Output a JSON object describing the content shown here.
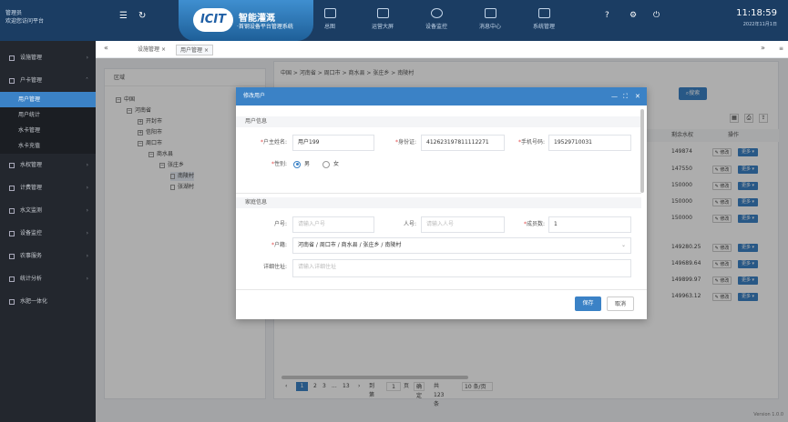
{
  "header": {
    "user_role": "管理员",
    "welcome": "欢迎您访问平台",
    "logo_mark": "ICIT",
    "logo_title": "智能灌溉",
    "logo_subtitle": "·首钢设备平台管理系统",
    "nav": [
      "总图",
      "运营大屏",
      "设备监控",
      "消息中心",
      "系统管理"
    ],
    "time": "11:18:59",
    "date": "2022年11月1日"
  },
  "sidebar": {
    "items": [
      {
        "label": "设施管理",
        "arrow": "›"
      },
      {
        "label": "户卡管理",
        "arrow": "˄"
      },
      {
        "label": "水权管理",
        "arrow": "›"
      },
      {
        "label": "计费管理",
        "arrow": "›"
      },
      {
        "label": "水文监测",
        "arrow": "›"
      },
      {
        "label": "设备监控",
        "arrow": "›"
      },
      {
        "label": "农事服务",
        "arrow": "›"
      },
      {
        "label": "统计分析",
        "arrow": "›"
      },
      {
        "label": "水肥一体化",
        "arrow": ""
      }
    ],
    "subitems": [
      "用户管理",
      "用户统计",
      "水卡管理",
      "水卡充值"
    ]
  },
  "tabs": {
    "nav_back": "«",
    "nav_fwd": "»",
    "items": [
      "设施管理",
      "用户管理"
    ],
    "close": "×"
  },
  "tree": {
    "title": "区域",
    "nodes": [
      "中国",
      "河南省",
      "开封市",
      "信阳市",
      "周口市",
      "商水县",
      "张庄乡",
      "南陵村",
      "张湖村"
    ]
  },
  "list": {
    "breadcrumb": "中国 > 河南省 > 周口市 > 商水县 > 张庄乡 > 南陵村",
    "search_label": "搜索",
    "col_balance": "剩余水权",
    "col_ops": "操作",
    "balances": [
      "149874",
      "147550",
      "150000",
      "150000",
      "150000",
      "149280.25",
      "149689.64",
      "149899.97",
      "149963.12"
    ],
    "edit_label": "✎ 修改",
    "more_label": "更多 ▾"
  },
  "pager": {
    "pages": [
      "1",
      "2",
      "3",
      "...",
      "13"
    ],
    "prev": "‹",
    "next": "›",
    "goto_label": "到第",
    "goto_value": "1",
    "page_unit": "页",
    "confirm": "确定",
    "total": "共 123 条",
    "page_size": "10 条/页"
  },
  "modal": {
    "title": "修改用户",
    "section_user": "用户信息",
    "name_label": "户主姓名:",
    "name_value": "用户199",
    "id_label": "身份证:",
    "id_value": "412623197811112271",
    "phone_label": "手机号码:",
    "phone_value": "19529710031",
    "gender_label": "性别:",
    "gender_options": [
      "男",
      "女"
    ],
    "section_family": "家庭信息",
    "household_label": "户号:",
    "household_placeholder": "请输入户号",
    "population_label": "人号:",
    "population_placeholder": "请输入人号",
    "members_label": "成员数:",
    "members_value": "1",
    "address_label": "户籍:",
    "address_value": "河南省 / 周口市 / 商水县 / 张庄乡 / 南陵村",
    "detail_label": "详细住址:",
    "detail_placeholder": "请输入详细住址",
    "save": "保存",
    "cancel": "取消"
  },
  "version": "Version 1.0.0",
  "colors": {
    "accent": "#3b82c6",
    "header": "#1b3d63",
    "sidebar": "#23272e"
  }
}
